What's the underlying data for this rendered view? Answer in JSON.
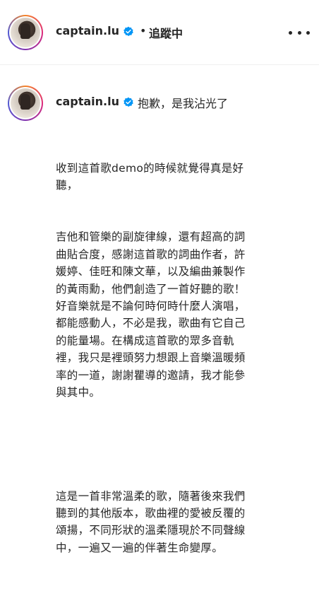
{
  "header": {
    "username": "captain.lu",
    "separator": "•",
    "follow_status": "追蹤中"
  },
  "comment": {
    "username": "captain.lu",
    "first_line": "抱歉，是我沾光了",
    "paragraphs": [
      "收到這首歌demo的時候就覺得真是好\n聽，",
      "吉他和管樂的副旋律線，還有超高的詞\n曲貼合度，感謝這首歌的詞曲作者，許\n媛婷、佳旺和陳文華，以及編曲兼製作\n的黃雨勳，他們創造了一首好聽的歌！\n好音樂就是不論何時何時什麼人演唱，\n都能感動人，不必是我，歌曲有它自己\n的能量場。在構成這首歌的眾多音軌\n裡，我只是裡頭努力想跟上音樂溫暖頻\n率的一道，謝謝瞿導的邀請，我才能參\n與其中。",
      "",
      "這是一首非常溫柔的歌，隨著後來我們\n聽到的其他版本，歌曲裡的愛被反覆的\n頌揚，不同形狀的溫柔隱現於不同聲線\n中，一遍又一遍的伴著生命變厚。"
    ]
  },
  "colors": {
    "verified": "#0095f6",
    "text": "#262626"
  },
  "icons": {
    "verified": "verified-badge-icon",
    "more": "more-options-icon"
  }
}
